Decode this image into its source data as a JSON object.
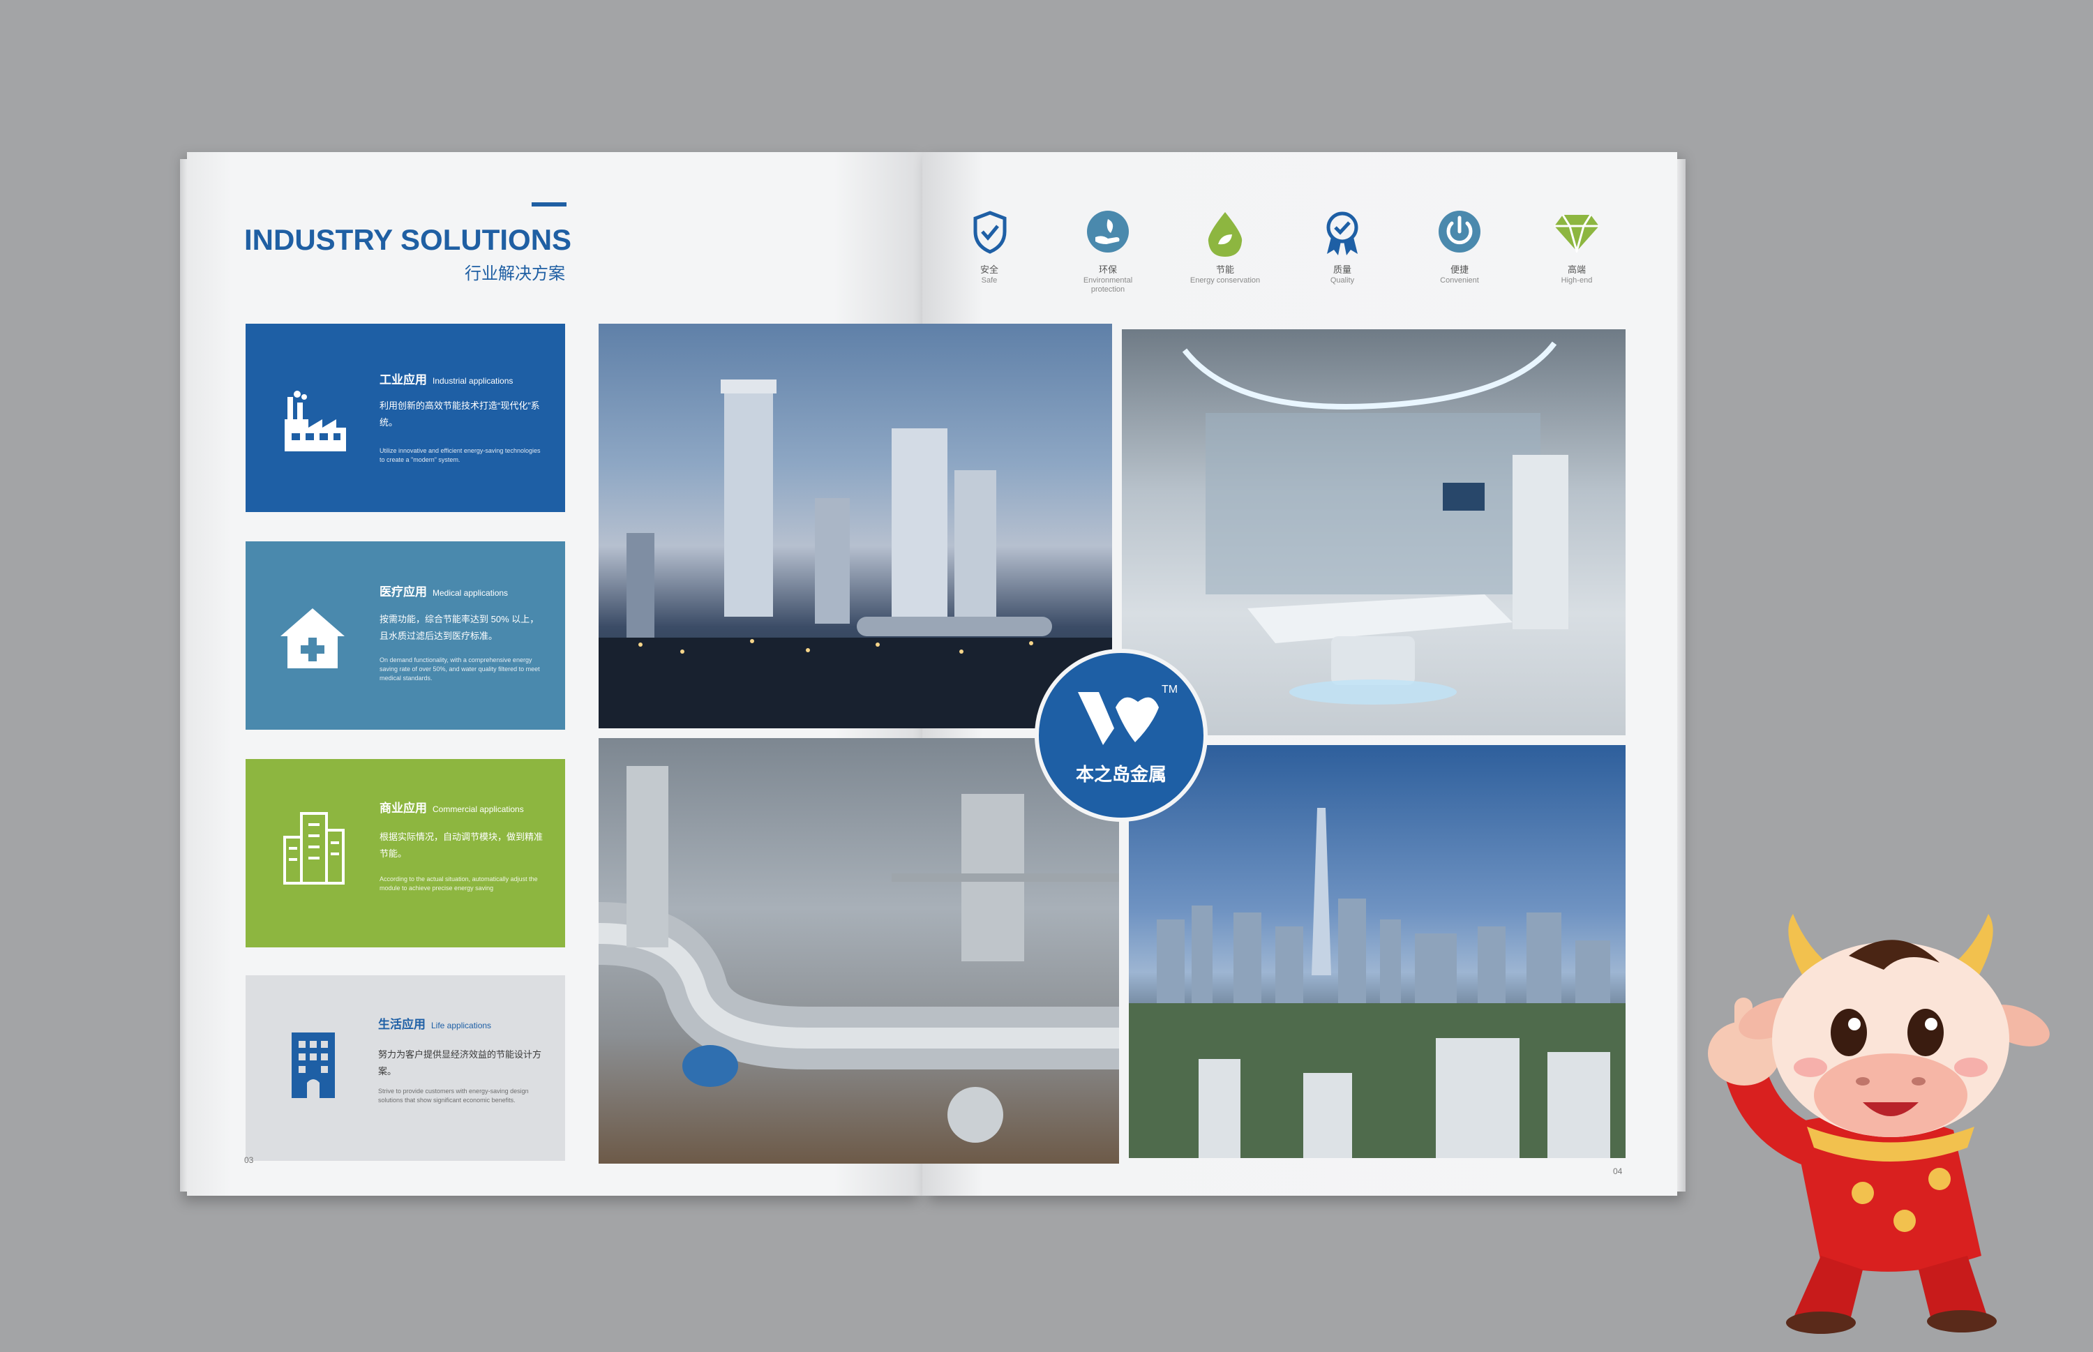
{
  "left_page": {
    "title_en": "INDUSTRY SOLUTIONS",
    "title_zh": "行业解决方案",
    "page_number": "03",
    "cards": [
      {
        "title_zh": "工业应用",
        "title_en": "Industrial applications",
        "body_zh": "利用创新的高效节能技术打造“现代化”系统。",
        "body_en": "Utilize innovative and efficient energy-saving technologies to create a \"modern\" system.",
        "color": "#1e5fa5",
        "icon": "factory-icon"
      },
      {
        "title_zh": "医疗应用",
        "title_en": "Medical applications",
        "body_zh": "按需功能，综合节能率达到 50% 以上，且水质过滤后达到医疗标准。",
        "body_en": "On demand functionality, with a comprehensive energy saving rate of over 50%, and water quality filtered to meet medical standards.",
        "color": "#4a89ad",
        "icon": "hospital-icon"
      },
      {
        "title_zh": "商业应用",
        "title_en": "Commercial applications",
        "body_zh": "根据实际情况，自动调节模块，做到精准节能。",
        "body_en": "According to the actual situation, automatically adjust the module to achieve precise energy saving",
        "color": "#8db640",
        "icon": "buildings-icon"
      },
      {
        "title_zh": "生活应用",
        "title_en": "Life applications",
        "body_zh": "努力为客户提供显经济效益的节能设计方案。",
        "body_en": "Strive to provide customers with energy-saving design solutions that show significant economic benefits.",
        "color": "#dcdee1",
        "icon": "apartment-icon"
      }
    ]
  },
  "right_page": {
    "page_number": "04",
    "features": [
      {
        "zh": "安全",
        "en": "Safe",
        "icon": "shield-check-icon",
        "color": "#1e5fa5"
      },
      {
        "zh": "环保",
        "en": "Environmental protection",
        "icon": "eco-hand-icon",
        "color": "#4a89ad"
      },
      {
        "zh": "节能",
        "en": "Energy conservation",
        "icon": "water-drop-icon",
        "color": "#8db640"
      },
      {
        "zh": "质量",
        "en": "Quality",
        "icon": "quality-badge-icon",
        "color": "#1e5fa5"
      },
      {
        "zh": "便捷",
        "en": "Convenient",
        "icon": "power-icon",
        "color": "#4a89ad"
      },
      {
        "zh": "高端",
        "en": "High-end",
        "icon": "diamond-icon",
        "color": "#8db640"
      }
    ]
  },
  "logo": {
    "text": "本之岛金属",
    "tm": "TM"
  }
}
